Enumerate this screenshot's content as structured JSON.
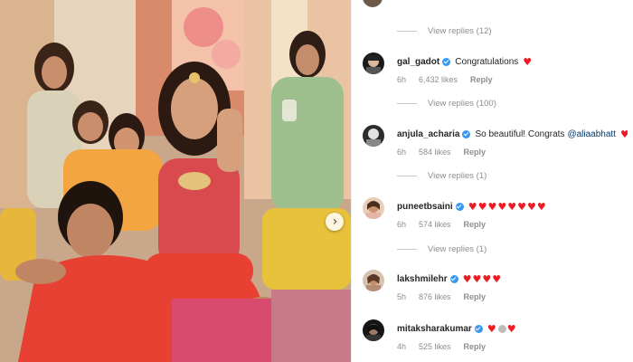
{
  "photo": {
    "next_icon": "chevron-right-icon"
  },
  "comments": [
    {
      "view_replies_above": "View replies (12)",
      "username": "gal_gadot",
      "verified": true,
      "text": "Congratulations",
      "mention": "",
      "hearts": 1,
      "time": "6h",
      "likes": "6,432 likes",
      "reply": "Reply"
    },
    {
      "view_replies_above": "View replies (100)",
      "username": "anjula_acharia",
      "verified": true,
      "text": "So beautiful! Congrats",
      "mention": "@aliaabhatt",
      "hearts": 1,
      "time": "6h",
      "likes": "584 likes",
      "reply": "Reply"
    },
    {
      "view_replies_above": "View replies (1)",
      "username": "puneetbsaini",
      "verified": true,
      "text": "",
      "mention": "",
      "hearts": 8,
      "time": "6h",
      "likes": "574 likes",
      "reply": "Reply"
    },
    {
      "view_replies_above": "View replies (1)",
      "username": "lakshmilehr",
      "verified": true,
      "text": "",
      "mention": "",
      "hearts": 4,
      "time": "5h",
      "likes": "876 likes",
      "reply": "Reply"
    },
    {
      "view_replies_above": "",
      "username": "mitaksharakumar",
      "verified": true,
      "text": "",
      "mention": "",
      "hearts": 2,
      "time": "4h",
      "likes": "525 likes",
      "reply": "Reply"
    }
  ],
  "colors": {
    "heart": "#ed1c24",
    "verified": "#3897f0",
    "meta_text": "#8e8e8e",
    "mention": "#00376b"
  }
}
